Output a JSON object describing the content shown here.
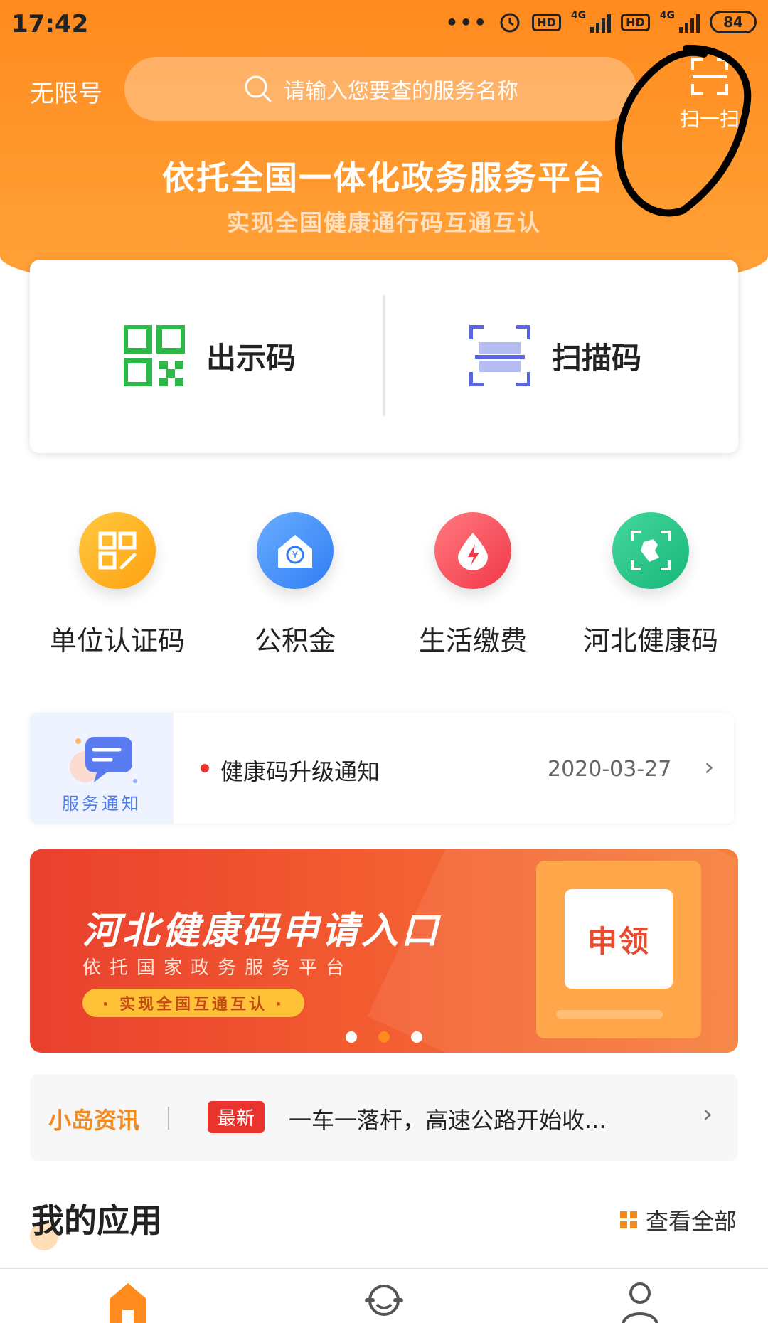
{
  "status_bar": {
    "time": "17:42",
    "network": "4G",
    "hd": "HD",
    "battery": "84"
  },
  "header": {
    "carrier": "无限号",
    "search_placeholder": "请输入您要查的服务名称",
    "scan_label": "扫一扫",
    "slogan": "依托全国一体化政务服务平台",
    "subslogan": "实现全国健康通行码互通互认"
  },
  "code_card": {
    "show_code": "出示码",
    "scan_code": "扫描码"
  },
  "quick_services": [
    {
      "label": "单位认证码",
      "icon": "qr-edit-icon",
      "color": "#ffb21f"
    },
    {
      "label": "公积金",
      "icon": "house-fund-icon",
      "color": "#3d8bff"
    },
    {
      "label": "生活缴费",
      "icon": "water-drop-bolt-icon",
      "color": "#ff4a55"
    },
    {
      "label": "河北健康码",
      "icon": "map-scan-icon",
      "color": "#1fc487"
    }
  ],
  "notice": {
    "badge": "服务通知",
    "title": "健康码升级通知",
    "date": "2020-03-27"
  },
  "banner": {
    "title": "河北健康码申请入口",
    "subtitle": "依托国家政务服务平台",
    "pill": "· 实现全国互通互认 ·",
    "button": "申领",
    "active_slide": 2,
    "slide_count": 3
  },
  "news": {
    "brand": "小岛资讯",
    "tag": "最新",
    "headline": "一车一落杆，高速公路开始收..."
  },
  "my_apps": {
    "title": "我的应用",
    "view_all": "查看全部"
  },
  "tabbar": {
    "icons": [
      "home-icon",
      "service-icon",
      "profile-icon"
    ],
    "active_color": "#ff8a1e"
  }
}
